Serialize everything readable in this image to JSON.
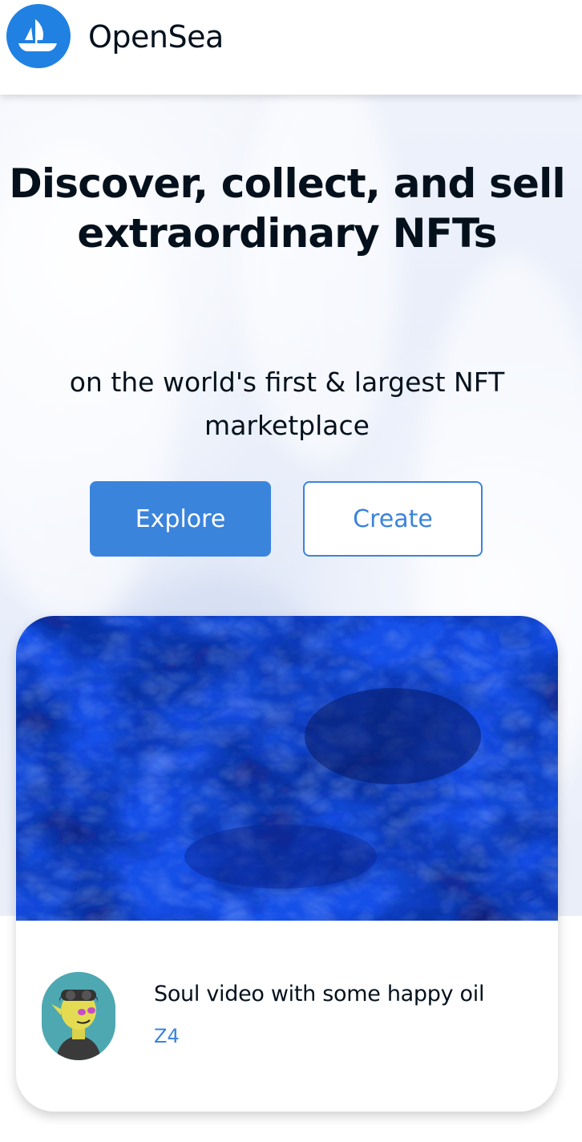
{
  "header": {
    "brand": "OpenSea",
    "logo_icon": "opensea-boat-icon",
    "logo_color": "#2081e2"
  },
  "hero": {
    "headline": "Discover, collect, and sell extraordinary NFTs",
    "subheadline": "on the world's first & largest NFT marketplace",
    "explore_label": "Explore",
    "create_label": "Create",
    "accent_color": "#3b84dc"
  },
  "featured": {
    "title": "Soul video with some happy oil",
    "creator": "Z4"
  }
}
